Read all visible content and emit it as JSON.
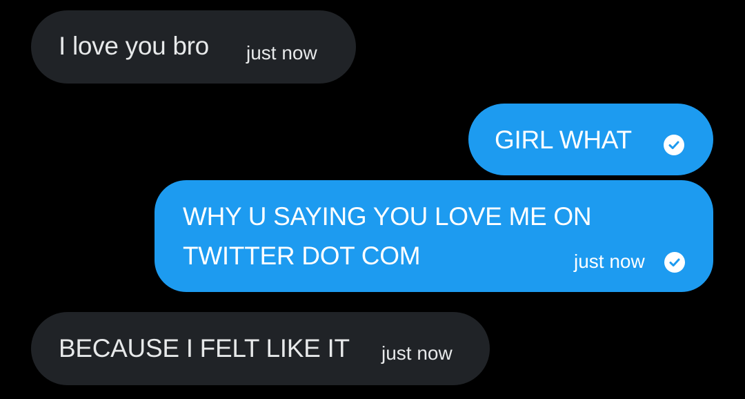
{
  "theme": {
    "background": "#000000",
    "received_bubble": "#202327",
    "sent_bubble": "#1d9bf0",
    "text": "#e7e9ea"
  },
  "messages": [
    {
      "direction": "received",
      "text": "I love you bro",
      "time": "just now"
    },
    {
      "direction": "sent",
      "text": "GIRL WHAT",
      "status_icon": "check-circle-icon"
    },
    {
      "direction": "sent",
      "text_line_1": "WHY U SAYING YOU LOVE ME ON",
      "text_line_2": "TWITTER DOT COM",
      "time": "just now",
      "status_icon": "check-circle-icon"
    },
    {
      "direction": "received",
      "text": "BECAUSE I FELT LIKE IT",
      "time": "just now"
    }
  ]
}
